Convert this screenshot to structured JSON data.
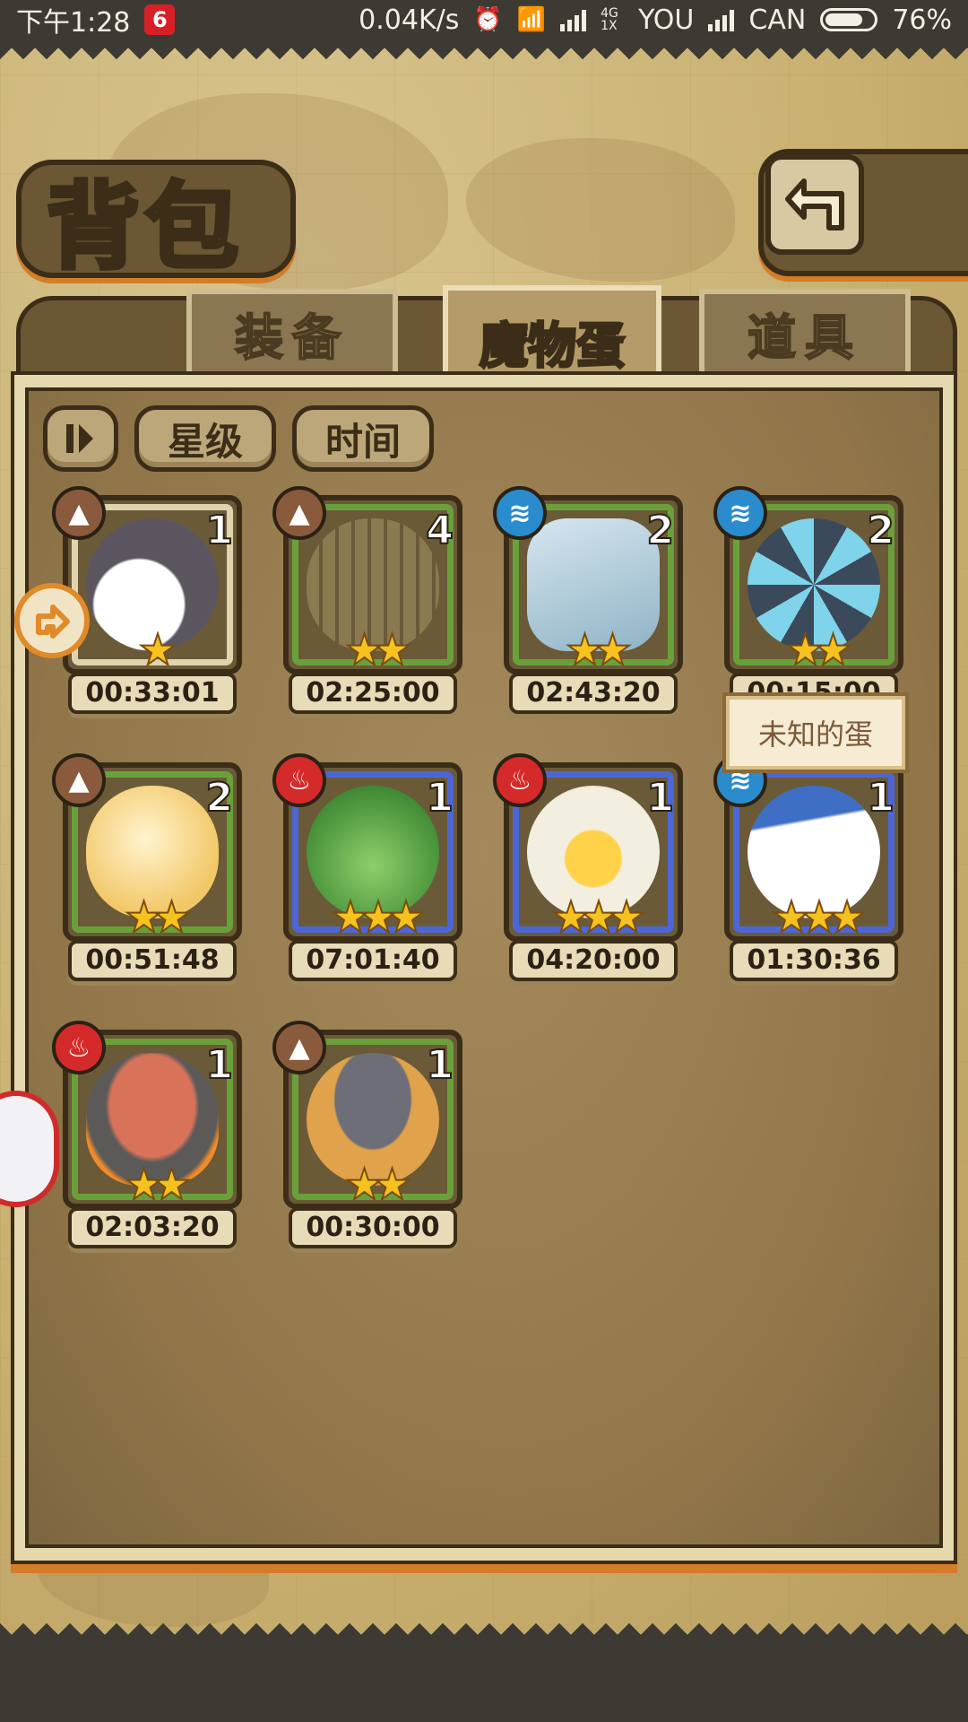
{
  "status_bar": {
    "time": "下午1:28",
    "app_badge": "6",
    "net_speed": "0.04K/s",
    "network": "4G 1X",
    "carrier1": "YOU",
    "carrier2": "CAN",
    "battery": "76%",
    "battery_level": 0.76
  },
  "header": {
    "title": "背包",
    "back_icon": "return-arrow-icon"
  },
  "tabs": [
    {
      "label": "装备",
      "active": false
    },
    {
      "label": "魔物蛋",
      "active": true
    },
    {
      "label": "道具",
      "active": false
    }
  ],
  "sort": {
    "toggle_icon": "sort-toggle-icon",
    "star_label": "星级",
    "time_label": "时间"
  },
  "tooltip": {
    "text": "未知的蛋"
  },
  "eggs": [
    {
      "element": "earth",
      "count": "1",
      "stars": "★",
      "timer": "00:33:01",
      "frame": "selected",
      "art": "grey-white-egg"
    },
    {
      "element": "earth",
      "count": "4",
      "stars": "★★",
      "timer": "02:25:00",
      "frame": "green",
      "art": "leaf-wrapped-egg"
    },
    {
      "element": "water",
      "count": "2",
      "stars": "★★",
      "timer": "02:43:20",
      "frame": "green",
      "art": "ice-crystal-egg"
    },
    {
      "element": "water",
      "count": "2",
      "stars": "★★",
      "timer": "00:15:00",
      "frame": "green",
      "art": "swirl-shell-egg"
    },
    {
      "element": "earth",
      "count": "2",
      "stars": "★★",
      "timer": "00:51:48",
      "frame": "green",
      "art": "golden-cloud-egg"
    },
    {
      "element": "fire",
      "count": "1",
      "stars": "★★★",
      "timer": "07:01:40",
      "frame": "blue",
      "art": "cactus-egg"
    },
    {
      "element": "fire",
      "count": "1",
      "stars": "★★★",
      "timer": "04:20:00",
      "frame": "blue",
      "art": "lightning-sun-egg"
    },
    {
      "element": "water",
      "count": "1",
      "stars": "★★★",
      "timer": "01:30:36",
      "frame": "blue",
      "art": "sailor-egg"
    },
    {
      "element": "fire",
      "count": "1",
      "stars": "★★",
      "timer": "02:03:20",
      "frame": "green",
      "art": "burning-rock-egg"
    },
    {
      "element": "earth",
      "count": "1",
      "stars": "★★",
      "timer": "00:30:00",
      "frame": "green",
      "art": "hat-egg"
    }
  ],
  "colors": {
    "accent_orange": "#d47c28",
    "frame_green": "#6aa03a",
    "frame_blue": "#4d66d6",
    "element_earth": "#8a5a3c",
    "element_water": "#2a8ccc",
    "element_fire": "#d42a2a"
  }
}
